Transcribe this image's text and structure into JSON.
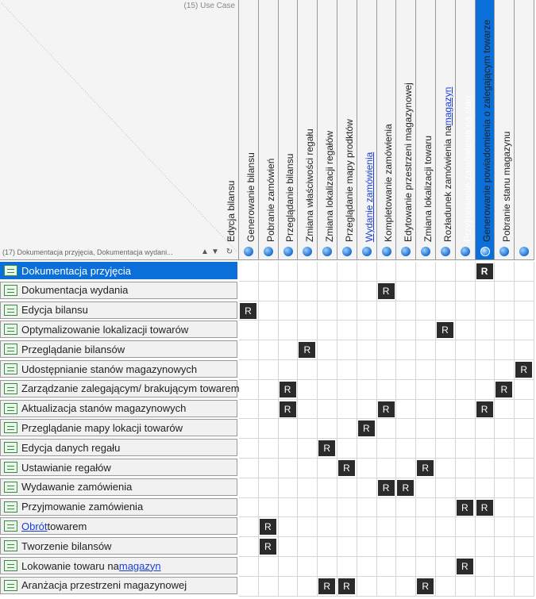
{
  "corner": {
    "top_label": "(15) Use Case",
    "bottom_label": "(17) Dokumentacja przyjęcia, Dokumentacja wydani...",
    "controls": [
      "›",
      "‹",
      "▲",
      "▼",
      "↻"
    ]
  },
  "columns": [
    {
      "label": "Edycja bilansu"
    },
    {
      "label": "Generowanie bilansu"
    },
    {
      "label": "Pobranie zamówień"
    },
    {
      "label": "Przeglądanie bilansu"
    },
    {
      "label": "Zmiana właściwości regału"
    },
    {
      "label": "Zmiana lokalizacji regałów"
    },
    {
      "label": "Przeglądanie mapy prodktów"
    },
    {
      "label": "Wydanie zamówienia",
      "link": true
    },
    {
      "label": "Kompletowanie zamówienia"
    },
    {
      "label": "Edytowanie przestrzeni magazynowej"
    },
    {
      "label": "Zmiana lokalizacji towaru"
    },
    {
      "label_pre": "Rozładunek zamówienia na ",
      "label_link": "magazyn"
    },
    {
      "label": "Przyjmowanie zamówienia na stan",
      "selected": true
    },
    {
      "label": "Generowanie powiadomienia o zalegającym towarze"
    },
    {
      "label": "Pobranie stanu magazynu"
    }
  ],
  "rows": [
    {
      "label": "Dokumentacja przyjęcia",
      "selected": true,
      "marks": [
        12
      ]
    },
    {
      "label": "Dokumentacja wydania",
      "marks": [
        7
      ]
    },
    {
      "label": "Edycja bilansu",
      "marks": [
        0
      ]
    },
    {
      "label": "Optymalizowanie lokalizacji towarów",
      "marks": [
        10
      ]
    },
    {
      "label": "Przeglądanie bilansów",
      "marks": [
        3
      ]
    },
    {
      "label": "Udostępnianie stanów magazynowych",
      "marks": [
        14
      ]
    },
    {
      "label": "Zarządzanie zalegającym/ brakującym towarem",
      "marks": [
        2,
        13
      ]
    },
    {
      "label": "Aktualizacja stanów magazynowych",
      "marks": [
        2,
        7,
        12
      ]
    },
    {
      "label": "Przeglądanie mapy lokacji towarów",
      "marks": [
        6
      ]
    },
    {
      "label": "Edycja danych regału",
      "marks": [
        4
      ]
    },
    {
      "label": "Ustawianie regałów",
      "marks": [
        5,
        9
      ]
    },
    {
      "label": "Wydawanie zamówienia",
      "marks": [
        7,
        8
      ]
    },
    {
      "label": "Przyjmowanie zamówienia",
      "marks": [
        11,
        12
      ]
    },
    {
      "label_link": "Obrót",
      "label_post": " towarem",
      "marks": [
        1
      ]
    },
    {
      "label": "Tworzenie bilansów",
      "marks": [
        1
      ]
    },
    {
      "label_pre": "Lokowanie towaru na ",
      "label_link": "magazyn",
      "marks": [
        11
      ]
    },
    {
      "label": "Aranżacja przestrzeni magazynowej",
      "marks": [
        4,
        5,
        9
      ]
    }
  ],
  "mark_label": "R",
  "colors": {
    "selected": "#0a6fd8",
    "mark_bg": "#2b2b2b",
    "link": "#1a3fd6"
  }
}
